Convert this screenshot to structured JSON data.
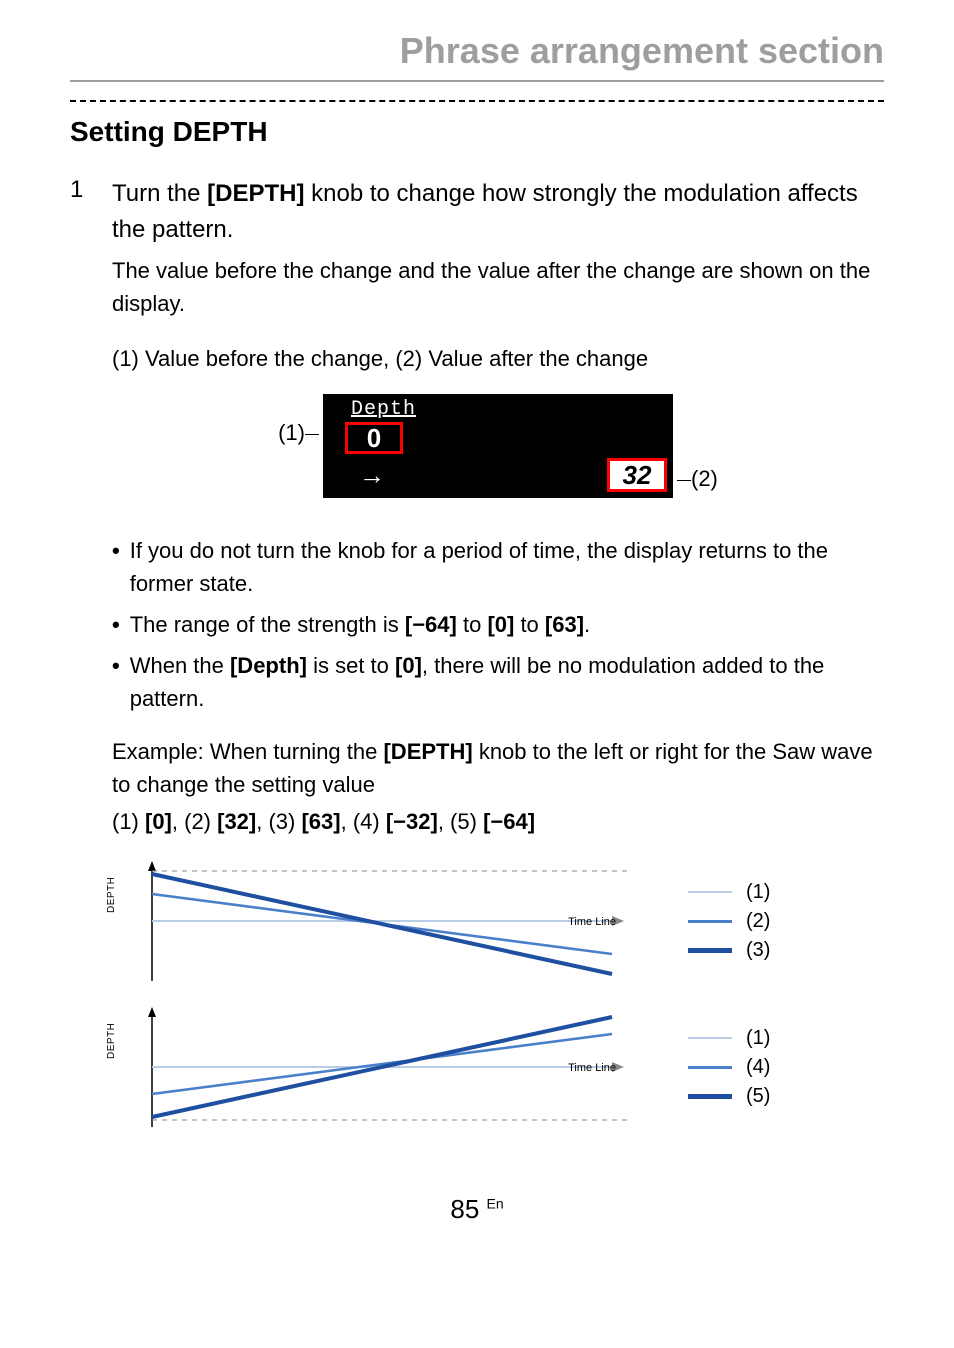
{
  "chapter": "Phrase arrangement section",
  "section": "Setting DEPTH",
  "step": {
    "num": "1",
    "lead_pre": "Turn the ",
    "lead_knob": "[DEPTH]",
    "lead_post": " knob to change how strongly the modulation affects the pattern.",
    "note": "The value before the change and the value after the change are shown on the display."
  },
  "caption": "(1) Value before the change, (2) Value after the change",
  "display": {
    "label": "Depth",
    "before": "0",
    "arrow": "→",
    "after": "32",
    "callout_left": "(1)",
    "callout_right": "(2)"
  },
  "bullets": {
    "b1": "If you do not turn the knob for a period of time, the display returns to the former state.",
    "b2_pre": "The range of the strength is ",
    "b2_a": "[−64]",
    "b2_to1": " to ",
    "b2_b": "[0]",
    "b2_to2": " to ",
    "b2_c": "[63]",
    "b2_end": ".",
    "b3_pre": "When the ",
    "b3_a": "[Depth]",
    "b3_mid": " is set to ",
    "b3_b": "[0]",
    "b3_post": ", there will be no modulation added to the pattern."
  },
  "example": {
    "pre": "Example: When turning the ",
    "knob": "[DEPTH]",
    "post": " knob to the left or right for the Saw wave to change the setting value"
  },
  "example_values": {
    "l1": "(1) ",
    "v1": "[0]",
    "l2": ", (2) ",
    "v2": "[32]",
    "l3": ", (3) ",
    "v3": "[63]",
    "l4": ", (4) ",
    "v4": "[−32]",
    "l5": ", (5) ",
    "v5": "[−64]"
  },
  "graph": {
    "y": "DEPTH",
    "x": "Time Line"
  },
  "legend_top": {
    "a": "(1)",
    "b": "(2)",
    "c": "(3)"
  },
  "legend_bottom": {
    "a": "(1)",
    "b": "(4)",
    "c": "(5)"
  },
  "chart_data": [
    {
      "type": "line",
      "title": "Saw wave DEPTH positive values",
      "xlabel": "Time Line",
      "ylabel": "DEPTH",
      "series": [
        {
          "name": "(1) [0]",
          "values": [
            [
              0,
              0
            ],
            [
              1,
              0
            ]
          ]
        },
        {
          "name": "(2) [32]",
          "values": [
            [
              0,
              32
            ],
            [
              1,
              0
            ]
          ]
        },
        {
          "name": "(3) [63]",
          "values": [
            [
              0,
              63
            ],
            [
              1,
              0
            ]
          ]
        }
      ],
      "ylim": [
        -64,
        64
      ]
    },
    {
      "type": "line",
      "title": "Saw wave DEPTH negative values",
      "xlabel": "Time Line",
      "ylabel": "DEPTH",
      "series": [
        {
          "name": "(1) [0]",
          "values": [
            [
              0,
              0
            ],
            [
              1,
              0
            ]
          ]
        },
        {
          "name": "(4) [−32]",
          "values": [
            [
              0,
              -32
            ],
            [
              1,
              0
            ]
          ]
        },
        {
          "name": "(5) [−64]",
          "values": [
            [
              0,
              -64
            ],
            [
              1,
              0
            ]
          ]
        }
      ],
      "ylim": [
        -64,
        64
      ]
    }
  ],
  "footer": {
    "page": "85",
    "lang": "En"
  }
}
